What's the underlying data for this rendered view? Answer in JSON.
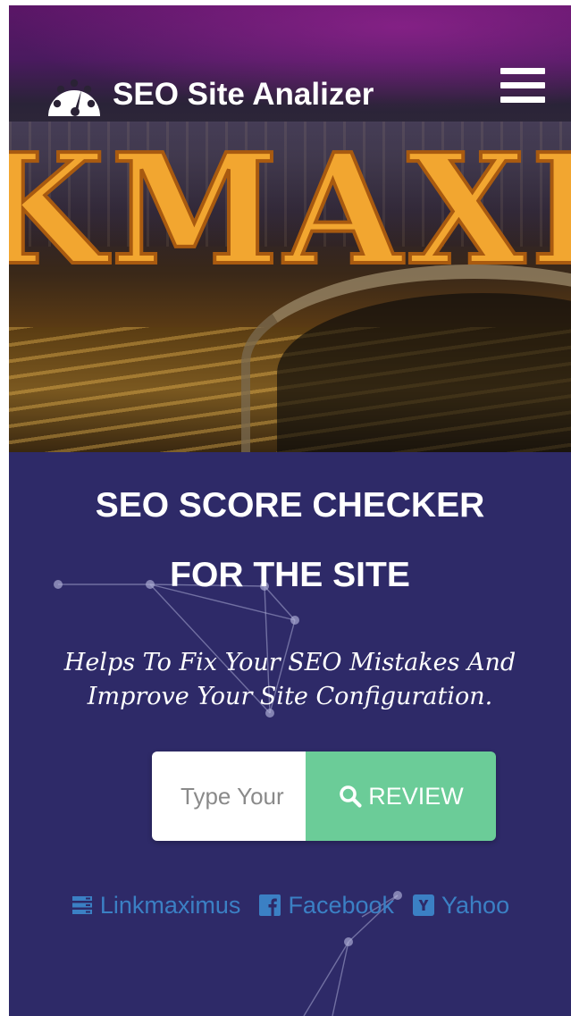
{
  "header": {
    "site_name": "SEO Site Analizer",
    "logo_icon": "speedometer-icon",
    "menu_icon": "hamburger-menu-icon"
  },
  "hero": {
    "banner_text": "KMAXIC"
  },
  "main": {
    "headline_line1": "SEO SCORE CHECKER",
    "headline_line2": "FOR THE SITE",
    "tagline_line1": "Helps To Fix Your SEO Mistakes And",
    "tagline_line2": "Improve Your Site Configuration.",
    "search": {
      "placeholder": "Type Your",
      "button_label": "REVIEW",
      "button_icon": "search-icon"
    },
    "links": [
      {
        "label": "Linkmaximus",
        "icon": "server-icon"
      },
      {
        "label": "Facebook",
        "icon": "facebook-icon"
      },
      {
        "label": "Yahoo",
        "icon": "yahoo-icon"
      }
    ]
  },
  "colors": {
    "section_background": "#2e2a68",
    "review_button": "#6bcc98",
    "link_color": "#3b80c4",
    "text_white": "#ffffff"
  }
}
